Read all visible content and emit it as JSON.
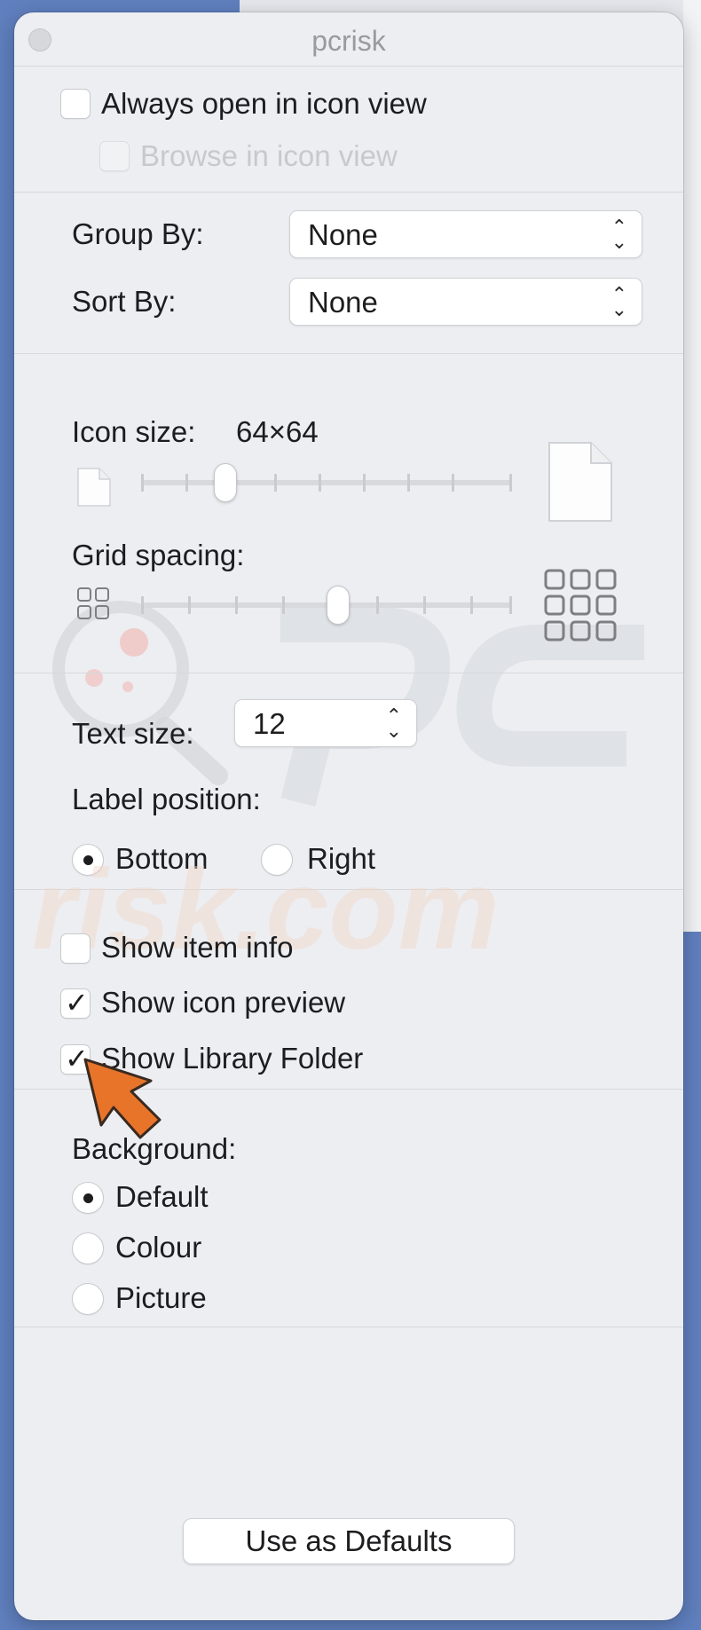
{
  "window": {
    "title": "pcrisk"
  },
  "view_options": {
    "always_open_icon_view": {
      "label": "Always open in icon view",
      "checked": false
    },
    "browse_icon_view": {
      "label": "Browse in icon view",
      "checked": false,
      "enabled": false
    },
    "group_by": {
      "label": "Group By:",
      "value": "None"
    },
    "sort_by": {
      "label": "Sort By:",
      "value": "None"
    },
    "icon_size": {
      "label": "Icon size:",
      "value": "64×64",
      "slider_fraction": 0.23
    },
    "grid_spacing": {
      "label": "Grid spacing:",
      "slider_fraction": 0.54
    },
    "text_size": {
      "label": "Text size:",
      "value": "12"
    },
    "label_position": {
      "label": "Label position:",
      "options": [
        {
          "label": "Bottom",
          "selected": true
        },
        {
          "label": "Right",
          "selected": false
        }
      ]
    },
    "show_item_info": {
      "label": "Show item info",
      "checked": false
    },
    "show_icon_preview": {
      "label": "Show icon preview",
      "checked": true
    },
    "show_library_folder": {
      "label": "Show Library Folder",
      "checked": true
    },
    "background": {
      "label": "Background:",
      "options": [
        {
          "label": "Default",
          "selected": true
        },
        {
          "label": "Colour",
          "selected": false
        },
        {
          "label": "Picture",
          "selected": false
        }
      ]
    },
    "use_defaults_label": "Use as Defaults"
  },
  "icons": {
    "popup_arrows": "up-down-chevron-icon",
    "small_document": "document-icon",
    "large_document": "document-icon",
    "grid_small": "grid-icon",
    "grid_large": "grid-icon",
    "checkmark": "checkmark-icon",
    "pointer": "arrow-pointer-icon"
  },
  "colors": {
    "desktop_background": "#5f7fbe",
    "window_background": "#eceef2",
    "pointer_arrow": "#e8742a"
  }
}
